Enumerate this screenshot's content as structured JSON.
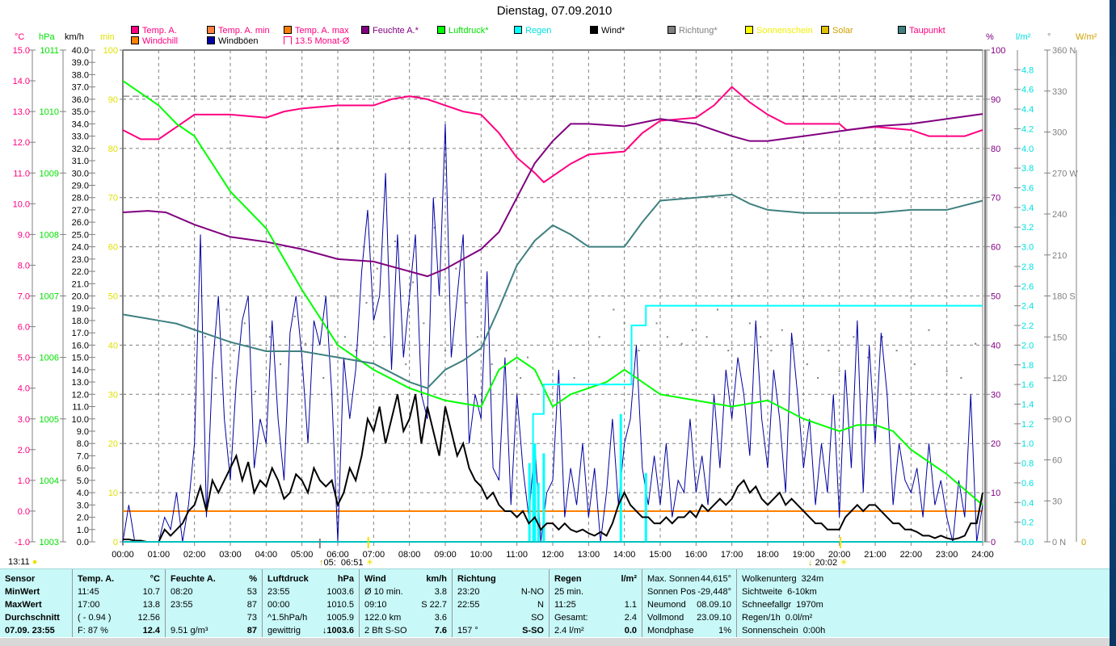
{
  "title": "Dienstag, 07.09.2010",
  "legend": [
    {
      "label": "Temp. A.",
      "box": "#ff0080",
      "text": "#ff0080"
    },
    {
      "label": "Temp. A. min",
      "box": "#ff8040",
      "text": "#ff0080"
    },
    {
      "label": "Temp. A. max",
      "box": "#ff8000",
      "text": "#ff0080"
    },
    {
      "label": "Feuchte A.*",
      "box": "#800080",
      "text": "#800080"
    },
    {
      "label": "Luftdruck*",
      "box": "#00ff00",
      "text": "#00e000"
    },
    {
      "label": "Regen",
      "box": "#00ffff",
      "text": "#00e0e0"
    },
    {
      "label": "Wind*",
      "box": "#000000",
      "text": "#000000"
    },
    {
      "label": "Richtung*",
      "box": "#808080",
      "text": "#808080"
    },
    {
      "label": "Sonnenschein",
      "box": "#ffff00",
      "text": "#f0f000"
    },
    {
      "label": "Solar",
      "box": "#e0c000",
      "text": "#d0a000"
    },
    {
      "label": "Taupunkt",
      "box": "#408080",
      "text": "#ff0080"
    },
    {
      "label": "Windchill",
      "box": "#ff8000",
      "text": "#ff0080"
    },
    {
      "label": "Windböen",
      "box": "#0000a0",
      "text": "#000000"
    },
    {
      "label": "13.5 Monat-Ø",
      "box": "#ffffff",
      "text": "#ff0080"
    }
  ],
  "units": {
    "temp": "°C",
    "hpa": "hPa",
    "kmh": "km/h",
    "min": "min",
    "pct": "%",
    "rain": "l/m²",
    "deg": "°",
    "solar": "W/m²"
  },
  "sun": {
    "left_time": "13:11",
    "moon_rise": "05:",
    "sunrise": "06:51",
    "sunset": "20:02"
  },
  "chart_data": {
    "type": "line",
    "title": "Dienstag, 07.09.2010",
    "x_ticks": [
      "00:00",
      "01:00",
      "02:00",
      "03:00",
      "04:00",
      "05:00",
      "06:00",
      "07:00",
      "08:00",
      "09:00",
      "10:00",
      "11:00",
      "12:00",
      "13:00",
      "14:00",
      "15:00",
      "16:00",
      "17:00",
      "18:00",
      "19:00",
      "20:00",
      "21:00",
      "22:00",
      "23:00",
      "24:00"
    ],
    "xlim": [
      0,
      24
    ],
    "axes": {
      "temp": [
        -1,
        15
      ],
      "hpa": [
        1003,
        1011
      ],
      "kmh": [
        0,
        40
      ],
      "min": [
        0,
        100
      ],
      "pct": [
        0,
        100
      ],
      "rain": [
        0,
        5
      ],
      "deg": [
        0,
        360
      ],
      "solar": [
        0,
        0
      ]
    },
    "deg_labels": {
      "360": "N",
      "270": "W",
      "180": "S",
      "90": "O",
      "0": "N"
    },
    "monthly_avg_temp": 13.5,
    "orange_line_temp": 0.0,
    "grid": true,
    "series": [
      {
        "name": "Temp. A.",
        "axis": "temp",
        "color": "#ff0080",
        "width": 2,
        "x": [
          0,
          0.5,
          1,
          1.5,
          2,
          3,
          4,
          4.5,
          5,
          6,
          7,
          7.5,
          8,
          8.5,
          9,
          9.5,
          10,
          10.5,
          11,
          11.5,
          11.75,
          12,
          12.5,
          13,
          14,
          14.5,
          15,
          16,
          16.5,
          17,
          17.5,
          18,
          18.5,
          20,
          20.2,
          21,
          22,
          22.5,
          23.5,
          24
        ],
        "y": [
          12.4,
          12.1,
          12.1,
          12.5,
          12.9,
          12.9,
          12.8,
          13.0,
          13.1,
          13.2,
          13.2,
          13.4,
          13.5,
          13.4,
          13.2,
          13.0,
          12.9,
          12.3,
          11.5,
          11.0,
          10.7,
          10.9,
          11.3,
          11.6,
          11.7,
          12.3,
          12.7,
          12.8,
          13.2,
          13.8,
          13.3,
          12.9,
          12.6,
          12.6,
          12.4,
          12.5,
          12.4,
          12.2,
          12.2,
          12.4
        ]
      },
      {
        "name": "Feuchte A.",
        "axis": "pct",
        "color": "#800080",
        "width": 2,
        "x": [
          0,
          0.7,
          1.2,
          2,
          3,
          4,
          5,
          6,
          7,
          8,
          8.5,
          9,
          10,
          10.5,
          11,
          11.5,
          12,
          12.5,
          13,
          14,
          15,
          16,
          17,
          17.5,
          18,
          19,
          20,
          21,
          22,
          23,
          24
        ],
        "y": [
          67,
          67.3,
          67,
          64.5,
          62,
          61,
          59.5,
          57.5,
          57,
          55,
          54,
          55.5,
          59.5,
          63,
          70,
          77,
          81.5,
          85,
          85,
          84.5,
          86,
          85,
          82.5,
          81.5,
          81.5,
          82.5,
          83.5,
          84.5,
          85,
          86,
          87
        ]
      },
      {
        "name": "Luftdruck",
        "axis": "hpa",
        "color": "#00ff00",
        "width": 2,
        "x": [
          0,
          0.5,
          1,
          1.5,
          2,
          3,
          4,
          5,
          6,
          7,
          8,
          9,
          10,
          10.5,
          11,
          11.5,
          12,
          12.5,
          13,
          13.5,
          14,
          14.5,
          15,
          16,
          17,
          18,
          19,
          20,
          20.5,
          21,
          21.5,
          22,
          23,
          24
        ],
        "y": [
          1010.5,
          1010.3,
          1010.1,
          1009.8,
          1009.6,
          1008.7,
          1008.1,
          1007.1,
          1006.2,
          1005.8,
          1005.5,
          1005.3,
          1005.2,
          1005.8,
          1006.0,
          1005.8,
          1005.2,
          1005.4,
          1005.5,
          1005.6,
          1005.8,
          1005.6,
          1005.4,
          1005.3,
          1005.2,
          1005.3,
          1005.0,
          1004.8,
          1004.9,
          1004.9,
          1004.8,
          1004.5,
          1004.1,
          1003.6
        ]
      },
      {
        "name": "Taupunkt",
        "axis": "temp",
        "color": "#408080",
        "width": 2,
        "x": [
          0,
          0.5,
          1,
          1.5,
          2,
          3,
          4,
          5,
          6,
          7,
          8,
          8.5,
          9,
          9.5,
          10,
          10.5,
          11,
          11.5,
          12,
          12.5,
          13,
          14,
          14.5,
          15,
          16,
          17,
          17.5,
          18,
          19,
          20,
          21,
          22,
          23,
          24
        ],
        "y": [
          6.4,
          6.3,
          6.2,
          6.1,
          5.9,
          5.5,
          5.2,
          5.2,
          5.0,
          4.8,
          4.2,
          4.0,
          4.6,
          4.9,
          5.3,
          6.6,
          8.0,
          8.8,
          9.3,
          9.0,
          8.6,
          8.6,
          9.4,
          10.1,
          10.2,
          10.3,
          10.0,
          9.8,
          9.7,
          9.7,
          9.7,
          9.8,
          9.8,
          10.1
        ]
      },
      {
        "name": "Regen",
        "axis": "rain",
        "color": "#00ffff",
        "width": 2,
        "step": true,
        "x": [
          0,
          11.4,
          11.45,
          11.75,
          13.9,
          14.2,
          14.6,
          24
        ],
        "y": [
          0,
          0,
          1.3,
          1.6,
          1.6,
          2.2,
          2.4,
          2.4
        ]
      }
    ],
    "wind": {
      "name": "Wind",
      "axis": "kmh",
      "color": "#000000",
      "interval_min": 10,
      "values": [
        0.2,
        0.2,
        0.1,
        0.1,
        0,
        0,
        0,
        1,
        0.5,
        1,
        1.5,
        2.5,
        3,
        4.5,
        2.5,
        5,
        4,
        5,
        6,
        7,
        5,
        6.5,
        4,
        5,
        4.5,
        6,
        5,
        3.5,
        4,
        5.5,
        5,
        4,
        6,
        5,
        4.5,
        5,
        3,
        4,
        6,
        5,
        7,
        10,
        9,
        11,
        8,
        10,
        12,
        9,
        10,
        12,
        8,
        11,
        9,
        7,
        11,
        9,
        7,
        8,
        6,
        5,
        4.5,
        3.5,
        4,
        3,
        2.5,
        2.5,
        2,
        2.5,
        1.5,
        2,
        1,
        1.5,
        1.5,
        1,
        1.5,
        1,
        0.8,
        1,
        0.7,
        0.5,
        0.8,
        0.5,
        1.5,
        3,
        4,
        3,
        2.5,
        2,
        2,
        1.5,
        1.5,
        2,
        1.5,
        2,
        2,
        2.5,
        2,
        3,
        2.5,
        3,
        3.5,
        3,
        3.5,
        4.5,
        5,
        4,
        4.5,
        3.5,
        3,
        3.5,
        4,
        3,
        3.5,
        3,
        2.5,
        2,
        1.5,
        1.5,
        1,
        1,
        1,
        2,
        2.5,
        3,
        2.5,
        3,
        3,
        2.5,
        2,
        1.5,
        1.5,
        1,
        1,
        0.8,
        0.5,
        0.5,
        0.3,
        0.5,
        0.3,
        0.2,
        0.3,
        0.5,
        1.5,
        1.5,
        4
      ]
    },
    "gusts": {
      "name": "Windböen",
      "axis": "kmh",
      "color": "#0000a0",
      "interval_min": 10,
      "values": [
        0,
        3,
        0,
        0,
        0,
        0,
        0,
        2,
        1,
        4,
        0,
        3,
        8,
        25,
        2,
        14,
        20,
        10,
        5,
        13,
        18,
        20,
        6,
        10,
        8,
        18,
        10,
        5,
        17,
        20,
        15,
        8,
        18,
        16,
        20,
        12,
        0,
        15,
        10,
        14,
        22,
        27,
        18,
        20,
        30,
        14,
        25,
        15,
        20,
        25,
        12,
        10,
        28,
        20,
        34,
        15,
        20,
        25,
        8,
        12,
        10,
        22,
        6,
        5,
        15,
        3,
        12,
        6,
        2,
        8,
        0,
        4,
        5,
        14,
        2,
        6,
        3,
        8,
        2,
        6,
        0,
        4,
        10,
        3,
        8,
        10,
        16,
        6,
        3,
        7,
        3,
        8,
        2,
        5,
        4,
        10,
        4,
        7,
        3,
        12,
        6,
        14,
        10,
        15,
        12,
        7,
        18,
        10,
        6,
        14,
        10,
        4,
        17,
        12,
        6,
        10,
        3,
        8,
        4,
        12,
        2,
        14,
        6,
        18,
        4,
        16,
        8,
        17,
        12,
        3,
        8,
        5,
        4,
        6,
        2,
        8,
        3,
        5,
        2,
        0,
        5,
        2,
        12,
        0,
        3
      ]
    },
    "rain_rate_bars": {
      "axis": "rain",
      "color": "#00ffff",
      "x": [
        11.35,
        11.5,
        11.6,
        11.75,
        13.9,
        14.6
      ],
      "y": [
        0.8,
        1.0,
        0.6,
        0.9,
        1.3,
        0.7
      ]
    },
    "direction": {
      "name": "Richtung",
      "axis": "deg",
      "color": "#808080",
      "points": [
        [
          1.3,
          5
        ],
        [
          2.3,
          150
        ],
        [
          2.6,
          120
        ],
        [
          2.9,
          170
        ],
        [
          3.1,
          140
        ],
        [
          3.4,
          160
        ],
        [
          3.7,
          110
        ],
        [
          4.1,
          150
        ],
        [
          4.4,
          130
        ],
        [
          4.8,
          165
        ],
        [
          5.1,
          145
        ],
        [
          5.6,
          120
        ],
        [
          5.9,
          180
        ],
        [
          6.2,
          150
        ],
        [
          6.5,
          140
        ],
        [
          6.8,
          175
        ],
        [
          7.1,
          200
        ],
        [
          7.3,
          150
        ],
        [
          7.6,
          220
        ],
        [
          7.9,
          130
        ],
        [
          8.1,
          190
        ],
        [
          8.4,
          160
        ],
        [
          8.7,
          230
        ],
        [
          9.0,
          140
        ],
        [
          9.3,
          200
        ],
        [
          9.6,
          175
        ],
        [
          9.9,
          150
        ],
        [
          10.3,
          130
        ],
        [
          10.7,
          140
        ],
        [
          11.1,
          120
        ],
        [
          11.3,
          135
        ],
        [
          12.6,
          120
        ],
        [
          13.3,
          150
        ],
        [
          13.7,
          170
        ],
        [
          14.0,
          160
        ],
        [
          14.4,
          140
        ],
        [
          14.9,
          160
        ],
        [
          15.2,
          150
        ],
        [
          15.6,
          145
        ],
        [
          15.9,
          155
        ],
        [
          16.3,
          150
        ],
        [
          16.6,
          170
        ],
        [
          16.9,
          140
        ],
        [
          17.2,
          180
        ],
        [
          17.5,
          160
        ],
        [
          17.8,
          150
        ],
        [
          18.1,
          140
        ],
        [
          18.4,
          155
        ],
        [
          18.7,
          145
        ],
        [
          19.1,
          130
        ],
        [
          19.4,
          120
        ],
        [
          19.7,
          140
        ],
        [
          20.0,
          125
        ],
        [
          20.4,
          150
        ],
        [
          20.8,
          135
        ],
        [
          21.2,
          150
        ],
        [
          21.6,
          140
        ],
        [
          22.1,
          130
        ],
        [
          22.5,
          155
        ],
        [
          23.0,
          125
        ],
        [
          23.4,
          120
        ],
        [
          23.8,
          145
        ]
      ]
    }
  },
  "stats": {
    "sensor": [
      "Sensor",
      "MinWert",
      "MaxWert",
      "Durchschnitt",
      "07.09. 23:55"
    ],
    "columns": [
      {
        "header": "Temp. A.",
        "unit": "°C",
        "rows": [
          [
            "11:45",
            "10.7"
          ],
          [
            "17:00",
            "13.8"
          ],
          [
            "( - 0.94 )",
            "12.56"
          ],
          [
            "F: 87 %",
            "12.4"
          ]
        ]
      },
      {
        "header": "Feuchte A.",
        "unit": "%",
        "rows": [
          [
            "08:20",
            "53"
          ],
          [
            "23:55",
            "87"
          ],
          [
            "",
            "73"
          ],
          [
            "9.51 g/m³",
            "87"
          ]
        ]
      },
      {
        "header": "Luftdruck",
        "unit": "hPa",
        "rows": [
          [
            "23:55",
            "1003.6"
          ],
          [
            "00:00",
            "1010.5"
          ],
          [
            "^1.5hPa/h",
            "1005.9"
          ],
          [
            "gewittrig",
            "↓1003.6"
          ]
        ]
      },
      {
        "header": "Wind",
        "unit": "km/h",
        "rows": [
          [
            "Ø 10 min.",
            "3.8"
          ],
          [
            "09:10",
            "S 22.7"
          ],
          [
            "122.0 km",
            "3.6"
          ],
          [
            "2 Bft S-SO",
            "7.6"
          ]
        ]
      },
      {
        "header": "Richtung",
        "unit": "",
        "rows": [
          [
            "23:20",
            "N-NO"
          ],
          [
            "22:55",
            "N"
          ],
          [
            "",
            "SO"
          ],
          [
            "157 °",
            "S-SO"
          ]
        ]
      },
      {
        "header": "Regen",
        "unit": "l/m²",
        "rows": [
          [
            "25 min.",
            ""
          ],
          [
            "11:25",
            "1.1"
          ],
          [
            "Gesamt:",
            "2.4"
          ],
          [
            "2.4 l/m²",
            "0.0"
          ]
        ]
      }
    ],
    "astro": [
      [
        "Max. Sonnen",
        "44,615°"
      ],
      [
        "Sonnen Pos",
        "-29,448°"
      ],
      [
        "Neumond",
        "08.09.10"
      ],
      [
        "Vollmond",
        "23.09.10"
      ],
      [
        "Mondphase",
        "1%"
      ]
    ],
    "misc": [
      [
        "Wolkenunterg",
        "324m"
      ],
      [
        "Sichtweite",
        "6-10km"
      ],
      [
        "Schneefallgr",
        "1970m"
      ],
      [
        "Regen/1h",
        "0.0l/m²"
      ],
      [
        "Sonnenschein",
        "0:00h"
      ]
    ]
  }
}
